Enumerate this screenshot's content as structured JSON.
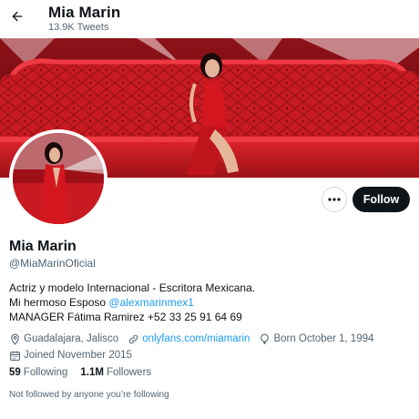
{
  "header": {
    "title": "Mia Marin",
    "tweet_count": "13.9K Tweets"
  },
  "profile": {
    "display_name": "Mia Marin",
    "handle": "@MiaMarinOficial",
    "bio_line1": "Actriz y modelo Internacional - Escritora Mexicana.",
    "bio_line2_prefix": "Mi hermoso Esposo ",
    "bio_line2_mention": "@alexmarinmex1",
    "bio_line3": "MANAGER Fátima Ramirez +52 33 25 91 64 69",
    "location": "Guadalajara, Jalisco",
    "website": "onlyfans.com/miamarin",
    "birthday": "Born October 1, 1994",
    "joined": "Joined November 2015"
  },
  "stats": {
    "following_count": "59",
    "following_label": "Following",
    "followers_count": "1.1M",
    "followers_label": "Followers"
  },
  "social_context": "Not followed by anyone you’re following",
  "actions": {
    "follow_label": "Follow"
  },
  "colors": {
    "accent": "#1d9bf0",
    "text": "#0f1419",
    "muted": "#536471",
    "button_dark": "#0f1419",
    "banner_red": "#c81a22"
  },
  "icons": {
    "back": "arrow-left-icon",
    "more": "more-horizontal-icon",
    "location": "location-pin-icon",
    "link": "link-icon",
    "birthday": "balloon-icon",
    "joined": "calendar-icon"
  }
}
